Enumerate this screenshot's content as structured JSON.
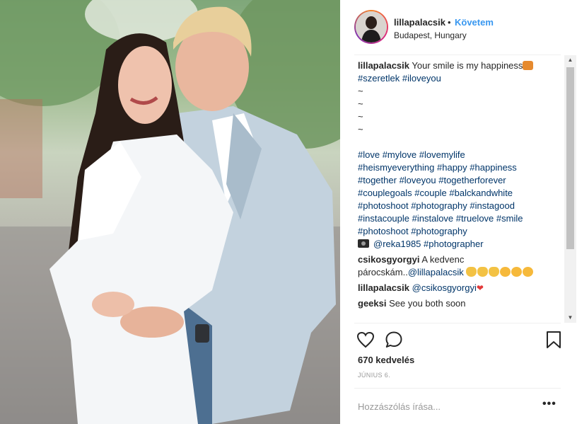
{
  "post": {
    "author": "lillapalacsik",
    "separator": "•",
    "follow_label": "Követem",
    "location": "Budapest, Hungary",
    "photo_alt": "photo"
  },
  "caption": {
    "author": "lillapalacsik",
    "text": " Your smile is my happiness",
    "line2": [
      "#szeretlek",
      " ",
      "#iloveyou"
    ],
    "tildes": [
      "~",
      "~",
      "~",
      "~"
    ],
    "hashtag_lines": [
      [
        "#love",
        "#mylove",
        "#lovemylife"
      ],
      [
        "#heismyeverything",
        "#happy",
        "#happiness"
      ],
      [
        "#together",
        "#loveyou",
        "#togetherforever"
      ],
      [
        "#couplegoals",
        "#couple",
        "#balckandwhite"
      ],
      [
        "#photoshoot",
        "#photography",
        "#instagood"
      ],
      [
        "#instacouple",
        "#instalove",
        "#truelove",
        "#smile"
      ],
      [
        "#photoshoot",
        "#photography"
      ]
    ],
    "credit_user": "@reka1985",
    "credit_tag": "#photographer"
  },
  "comments": [
    {
      "user": "csikosgyorgyi",
      "text_a": " A kedvenc",
      "text_b": "párocskám..",
      "mention": "@lillapalacsik"
    },
    {
      "user": "lillapalacsik",
      "mention": "@csikosgyorgyi"
    },
    {
      "user": "geeksi",
      "text": " See you both soon"
    }
  ],
  "icons": {
    "like": "heart-outline-icon",
    "comment": "speech-bubble-icon",
    "save": "bookmark-icon",
    "more": "ellipsis-icon"
  },
  "likes_label": "670 kedvelés",
  "date_label": "Június 6.",
  "comment_input": {
    "placeholder": "Hozzászólás írása...",
    "value": ""
  },
  "more_label": "•••",
  "scroll": {
    "up": "▲",
    "down": "▼"
  },
  "colors": {
    "link": "#003569",
    "follow": "#3897f0",
    "text": "#262626",
    "muted": "#999999"
  }
}
